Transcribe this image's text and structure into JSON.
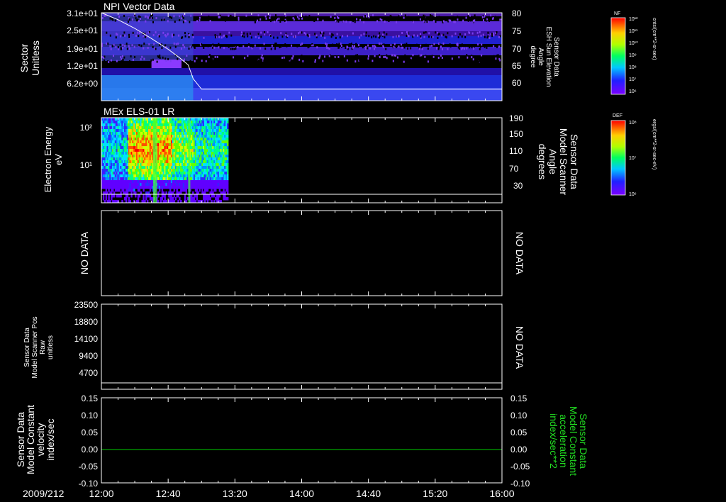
{
  "colors": {
    "background": "#000000",
    "frame": "#ffffff",
    "zero_line": "#00cc00",
    "secondary_axis_label": "#22dd22"
  },
  "time_axis": {
    "date_label": "2009/212",
    "ticks": [
      "12:00",
      "12:40",
      "13:20",
      "14:00",
      "14:40",
      "15:20",
      "16:00"
    ],
    "range": [
      "12:00",
      "16:00"
    ]
  },
  "panel1": {
    "title": "NPI Vector Data",
    "ylabel_lines": [
      "Sector",
      "Unitless"
    ],
    "yticks": [
      "3.1e+01",
      "2.5e+01",
      "1.9e+01",
      "1.2e+01",
      "6.2e+00"
    ],
    "y2label_lines": [
      "Sensor Data",
      "ESH Sun Elevation",
      "Angle",
      "degree"
    ],
    "y2ticks": [
      "80",
      "75",
      "70",
      "65",
      "60"
    ],
    "colorbar_code": "NF",
    "colorbar_ticks": [
      "10¹²",
      "10¹¹",
      "10¹⁰",
      "10⁹",
      "10⁸",
      "10⁷",
      "10⁶"
    ],
    "colorbar_units": "cnts/(cm**2-sr-sec)"
  },
  "panel2": {
    "title": "MEx ELS-01 LR",
    "ylabel_lines": [
      "Electron Energy",
      "eV"
    ],
    "yticks": [
      "10²",
      "10¹"
    ],
    "y2label_lines": [
      "Sensor Data",
      "Model Scanner",
      "Angle",
      "degrees"
    ],
    "y2ticks": [
      "190",
      "150",
      "110",
      "70",
      "30"
    ],
    "colorbar_code": "DEF",
    "colorbar_ticks": [
      "10⁸",
      "10⁷",
      "10⁶"
    ],
    "colorbar_units": "ergs/(cm**2-sr-sec-eV)"
  },
  "panel3": {
    "left_text": "NO DATA",
    "right_text": "NO DATA"
  },
  "panel4": {
    "ylabel_lines": [
      "Sensor Data",
      "Model Scanner Pos",
      "Raw",
      "unitless"
    ],
    "yticks": [
      "23500",
      "18800",
      "14100",
      "9400",
      "4700"
    ],
    "right_text": "NO DATA"
  },
  "panel5": {
    "ylabel_lines": [
      "Sensor Data",
      "Model Constant",
      "velocity",
      "index/sec"
    ],
    "yticks": [
      "0.15",
      "0.10",
      "0.05",
      "0.00",
      "-0.05",
      "-0.10"
    ],
    "y2label_lines": [
      "Sensor Data",
      "Model Constant",
      "acceleration",
      "index/sec**2"
    ],
    "y2ticks": [
      "0.15",
      "0.10",
      "0.05",
      "0.00",
      "-0.05",
      "-0.10"
    ]
  },
  "chart_data": [
    {
      "type": "heatmap",
      "title": "NPI Vector Data",
      "x_range": [
        "12:00",
        "16:00"
      ],
      "ylabel": "Sector Unitless",
      "overlay_line": {
        "name": "ESH Sun Elevation Angle",
        "x": [
          "12:00",
          "12:10",
          "12:20",
          "12:30",
          "12:40",
          "12:47",
          "12:52",
          "12:55",
          "13:00",
          "14:00",
          "15:00",
          "16:00"
        ],
        "y": [
          80,
          78,
          75.5,
          72.6,
          69.5,
          67,
          65,
          61,
          58,
          58,
          58,
          58
        ]
      }
    },
    {
      "type": "heatmap",
      "title": "MEx ELS-01 LR",
      "x_range": [
        "12:00",
        "16:00"
      ],
      "ylabel": "Electron Energy eV",
      "data_x_range": [
        "12:00",
        "13:16"
      ],
      "overlay_line": {
        "name": "Model Scanner Angle",
        "x": [
          "12:00",
          "16:00"
        ],
        "y": [
          15,
          15
        ]
      }
    },
    {
      "type": "line",
      "x_range": [
        "12:00",
        "16:00"
      ],
      "y_range": [
        -0.1,
        0.15
      ],
      "series": [
        {
          "x": [
            "12:00",
            "16:00"
          ],
          "values": [
            0,
            0
          ]
        }
      ]
    }
  ]
}
